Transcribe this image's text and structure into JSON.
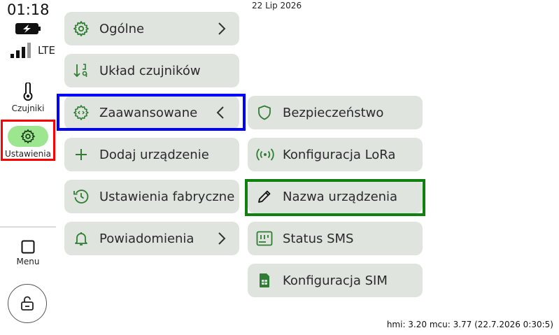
{
  "status": {
    "time": "01:18",
    "network": "LTE",
    "date": "22 Lip 2026"
  },
  "rail": {
    "sensors_label": "Czujniki",
    "settings_label": "Ustawienia",
    "menu_label": "Menu"
  },
  "menu": {
    "general": "Ogólne",
    "sensor_layout": "Układ czujników",
    "advanced": "Zaawansowane",
    "add_device": "Dodaj urządzenie",
    "factory_settings": "Ustawienia fabryczne",
    "notifications": "Powiadomienia"
  },
  "submenu": {
    "security": "Bezpieczeństwo",
    "lora_config": "Konfiguracja LoRa",
    "device_name": "Nazwa urządzenia",
    "sms_status": "Status SMS",
    "sim_config": "Konfiguracja SIM"
  },
  "footer": {
    "version": "hmi: 3.20 mcu: 3.77 (22.7.2026 0:30:5)"
  },
  "colors": {
    "accent_green": "#2e7d32",
    "button_bg": "#dfe4df",
    "selected_pill": "#9be68e",
    "highlight_red": "#ff0000",
    "highlight_blue": "#0000ff",
    "highlight_green": "#108010"
  },
  "icons": {
    "battery": "battery-charging-icon",
    "signal": "signal-bars-icon",
    "sensors": "thermometer-icon",
    "settings": "gear-icon",
    "menu": "square-icon",
    "lock": "lock-open-icon"
  }
}
